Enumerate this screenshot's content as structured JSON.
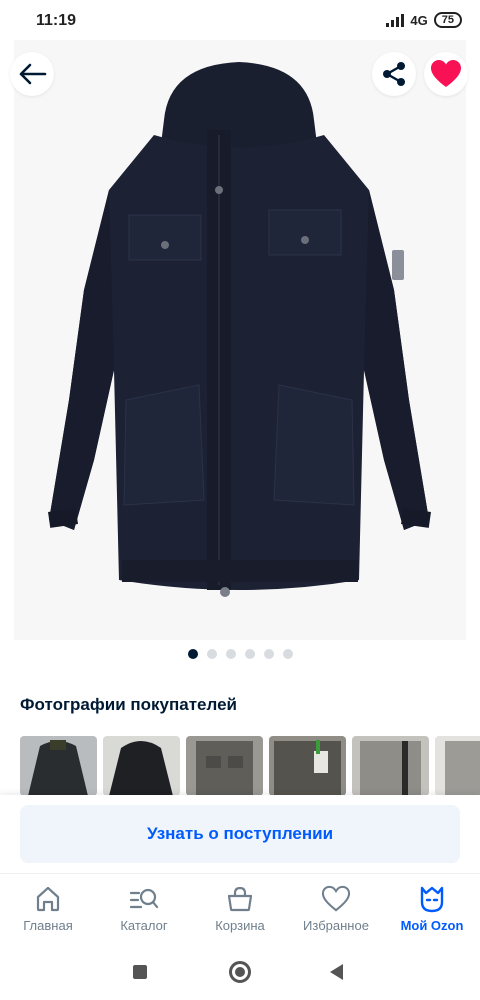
{
  "status": {
    "time": "11:19",
    "network": "4G",
    "battery": "75"
  },
  "product": {
    "image": "navy-parka-jacket",
    "gallery_count": 6,
    "gallery_active_index": 0
  },
  "customer_photos": {
    "title": "Фотографии покупателей",
    "count": 6
  },
  "actions": {
    "notify_label": "Узнать о поступлении"
  },
  "nav": {
    "items": [
      {
        "label": "Главная",
        "icon": "home-icon",
        "active": false
      },
      {
        "label": "Каталог",
        "icon": "catalog-search-icon",
        "active": false
      },
      {
        "label": "Корзина",
        "icon": "basket-icon",
        "active": false
      },
      {
        "label": "Избранное",
        "icon": "heart-icon",
        "active": false
      },
      {
        "label": "Мой Ozon",
        "icon": "ozon-profile-icon",
        "active": true
      }
    ]
  },
  "colors": {
    "accent": "#005bff",
    "favorite": "#f91155",
    "text_primary": "#001a34",
    "text_secondary": "#707f8d",
    "jacket": "#1c2133"
  }
}
